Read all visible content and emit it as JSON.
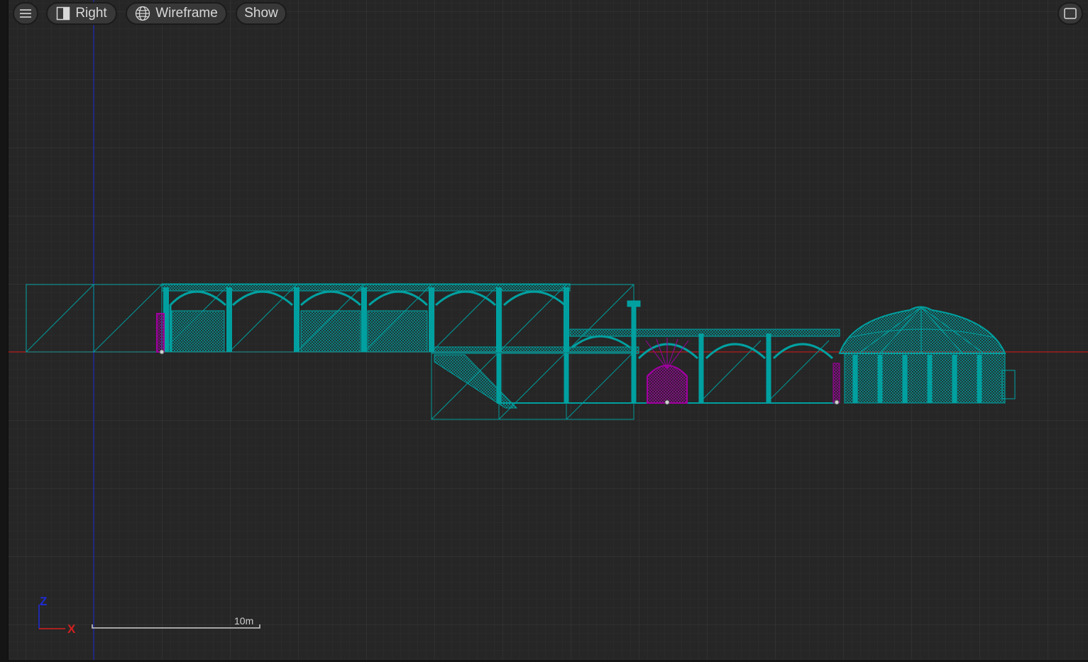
{
  "toolbar": {
    "menu_icon": "hamburger-menu-icon",
    "view_label": "Right",
    "view_icon": "view-panel-icon",
    "shading_label": "Wireframe",
    "shading_icon": "globe-wireframe-icon",
    "show_label": "Show",
    "maximize_icon": "maximize-window-icon"
  },
  "axes": {
    "vertical_label": "Z",
    "horizontal_label": "X",
    "vertical_color": "#1f2bd6",
    "horizontal_color": "#d61f1f"
  },
  "scale_bar": {
    "label": "10m"
  },
  "colors": {
    "background": "#262626",
    "grid_minor": "#303030",
    "grid_major": "#3a3a3a",
    "mesh": "#00a3a3",
    "selected_mesh": "#a000a0"
  }
}
